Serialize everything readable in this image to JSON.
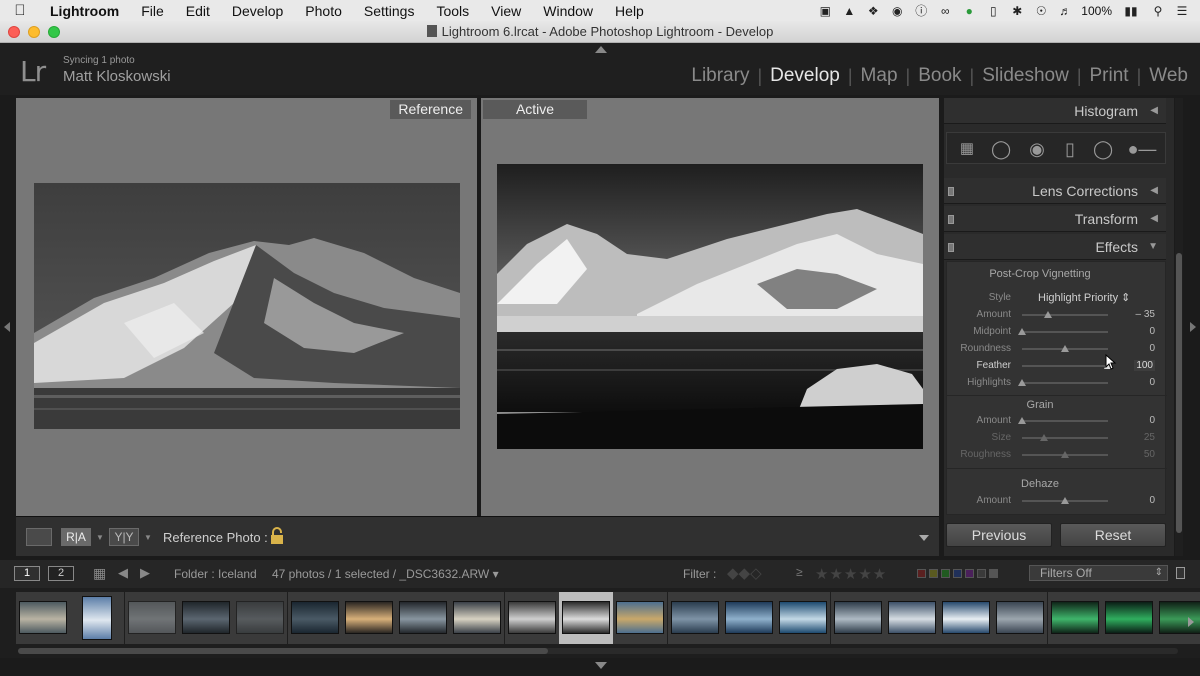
{
  "menubar": {
    "app_name": "Lightroom",
    "items": [
      "File",
      "Edit",
      "Develop",
      "Photo",
      "Settings",
      "Tools",
      "View",
      "Window",
      "Help"
    ],
    "battery": "100%"
  },
  "window": {
    "title": "Lightroom 6.lrcat - Adobe Photoshop Lightroom - Develop"
  },
  "identity": {
    "logo": "Lr",
    "sync_status": "Syncing 1 photo",
    "user_name": "Matt Kloskowski"
  },
  "modules": {
    "library": "Library",
    "develop": "Develop",
    "map": "Map",
    "book": "Book",
    "slideshow": "Slideshow",
    "print": "Print",
    "web": "Web",
    "separator": "|"
  },
  "view": {
    "reference_label": "Reference",
    "active_label": "Active"
  },
  "toolbar": {
    "ra_label": "R|A",
    "yy_label": "Y|Y",
    "reference_photo_label": "Reference Photo :"
  },
  "panel": {
    "histogram": "Histogram",
    "lens_corrections": "Lens Corrections",
    "transform": "Transform",
    "effects": "Effects",
    "vignetting": {
      "title": "Post-Crop Vignetting",
      "style_label": "Style",
      "style_value": "Highlight Priority",
      "amount_label": "Amount",
      "amount_value": "– 35",
      "amount_pos": 0.3,
      "midpoint_label": "Midpoint",
      "midpoint_value": "0",
      "midpoint_pos": 0.0,
      "roundness_label": "Roundness",
      "roundness_value": "0",
      "roundness_pos": 0.5,
      "feather_label": "Feather",
      "feather_value": "100",
      "feather_pos": 1.0,
      "highlights_label": "Highlights",
      "highlights_value": "0",
      "highlights_pos": 0.0
    },
    "grain": {
      "title": "Grain",
      "amount_label": "Amount",
      "amount_value": "0",
      "amount_pos": 0.0,
      "size_label": "Size",
      "size_value": "25",
      "size_pos": 0.25,
      "roughness_label": "Roughness",
      "roughness_value": "50",
      "roughness_pos": 0.5
    },
    "dehaze": {
      "title": "Dehaze",
      "amount_label": "Amount",
      "amount_value": "0",
      "amount_pos": 0.5
    },
    "previous_button": "Previous",
    "reset_button": "Reset"
  },
  "filmbar": {
    "screen1": "1",
    "screen2": "2",
    "folder": "Folder : Iceland",
    "count": "47 photos / 1 selected / _DSC3632.ARW ▾",
    "filter_label": "Filter :",
    "filters_value": "Filters Off"
  },
  "filmstrip": {
    "thumbs": [
      {
        "c1": "#4d5a60",
        "c2": "#b9b3a3"
      },
      {
        "c1": "#5c7ea8",
        "c2": "#dfe7ef"
      },
      {
        "c1": "#6a7075",
        "c2": "#9da4a8"
      },
      {
        "c1": "#20262b",
        "c2": "#5b6670"
      },
      {
        "c1": "#3a3f42",
        "c2": "#6f777c"
      },
      {
        "c1": "#1a2630",
        "c2": "#4a5a66"
      },
      {
        "c1": "#2a2622",
        "c2": "#d8b07a"
      },
      {
        "c1": "#23272c",
        "c2": "#8896a0"
      },
      {
        "c1": "#3a4048",
        "c2": "#d7d2c2"
      },
      {
        "c1": "#3a3a3a",
        "c2": "#cfcfcf"
      },
      {
        "c1": "#2b2b2b",
        "c2": "#dcdcdc"
      },
      {
        "c1": "#4d6f8f",
        "c2": "#c9a86a"
      },
      {
        "c1": "#2a3c4e",
        "c2": "#7e93a6"
      },
      {
        "c1": "#1f3b5a",
        "c2": "#8fb1cc"
      },
      {
        "c1": "#1d4a70",
        "c2": "#c3d8e6"
      },
      {
        "c1": "#2f3d4a",
        "c2": "#aebac4"
      },
      {
        "c1": "#3c5068",
        "c2": "#d6dde3"
      },
      {
        "c1": "#27496d",
        "c2": "#e8eef3"
      },
      {
        "c1": "#3a4552",
        "c2": "#9ca6ae"
      },
      {
        "c1": "#0f2418",
        "c2": "#3fb56b"
      },
      {
        "c1": "#0b1d16",
        "c2": "#2fae5e"
      },
      {
        "c1": "#102016",
        "c2": "#3b9a58"
      }
    ]
  }
}
